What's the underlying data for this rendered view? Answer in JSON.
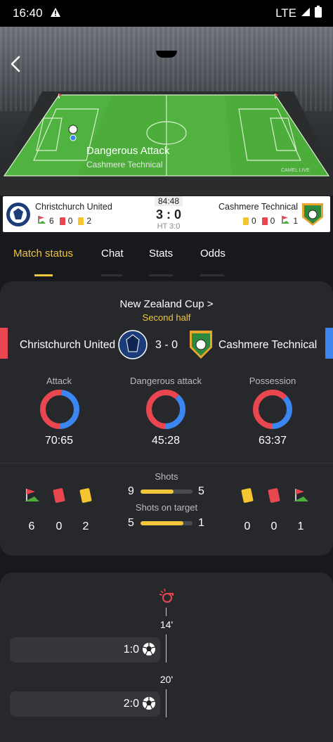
{
  "status_bar": {
    "time": "16:40",
    "network": "LTE"
  },
  "live_event": {
    "title": "Dangerous Attack",
    "team": "Cashmere Technical",
    "brand": "CAMEL LIVE"
  },
  "match": {
    "clock": "84:48",
    "score": "3 : 0",
    "half_time": "HT 3:0",
    "home": {
      "name": "Christchurch United",
      "corners": "6",
      "red": "0",
      "yellow": "2",
      "logo_text": "RAMS"
    },
    "away": {
      "name": "Cashmere Technical",
      "yellow": "0",
      "red": "0",
      "corners": "1",
      "logo_text": "CASHMERE TECHNICAL"
    }
  },
  "tabs": [
    {
      "label": "Match status",
      "active": true
    },
    {
      "label": "Chat"
    },
    {
      "label": "Stats"
    },
    {
      "label": "Odds"
    }
  ],
  "status_panel": {
    "league": "New Zealand Cup >",
    "phase": "Second half",
    "home_name": "Christchurch United",
    "away_name": "Cashmere Technical",
    "score": "3 - 0",
    "home_color": "#e9474f",
    "away_color": "#3b86f0",
    "rings": [
      {
        "label": "Attack",
        "value": "70:65",
        "home": 70,
        "away": 65
      },
      {
        "label": "Dangerous attack",
        "value": "45:28",
        "home": 45,
        "away": 28
      },
      {
        "label": "Possession",
        "value": "63:37",
        "home": 63,
        "away": 37
      }
    ],
    "shots": {
      "label": "Shots",
      "home": "9",
      "away": "5",
      "home_share": 0.64
    },
    "shots_on_target": {
      "label": "Shots on target",
      "home": "5",
      "away": "1",
      "home_share": 0.83
    },
    "home_counts": {
      "corners": "6",
      "red": "0",
      "yellow": "2"
    },
    "away_counts": {
      "yellow": "0",
      "red": "0",
      "corners": "1"
    }
  },
  "timeline": {
    "events": [
      {
        "minute": "14'",
        "score": "1:0"
      },
      {
        "minute": "20'",
        "score": "2:0"
      }
    ]
  },
  "colors": {
    "accent": "#f0c63c",
    "home": "#e9474f",
    "away": "#3b86f0",
    "panel": "#26282c",
    "background": "#17191c"
  }
}
